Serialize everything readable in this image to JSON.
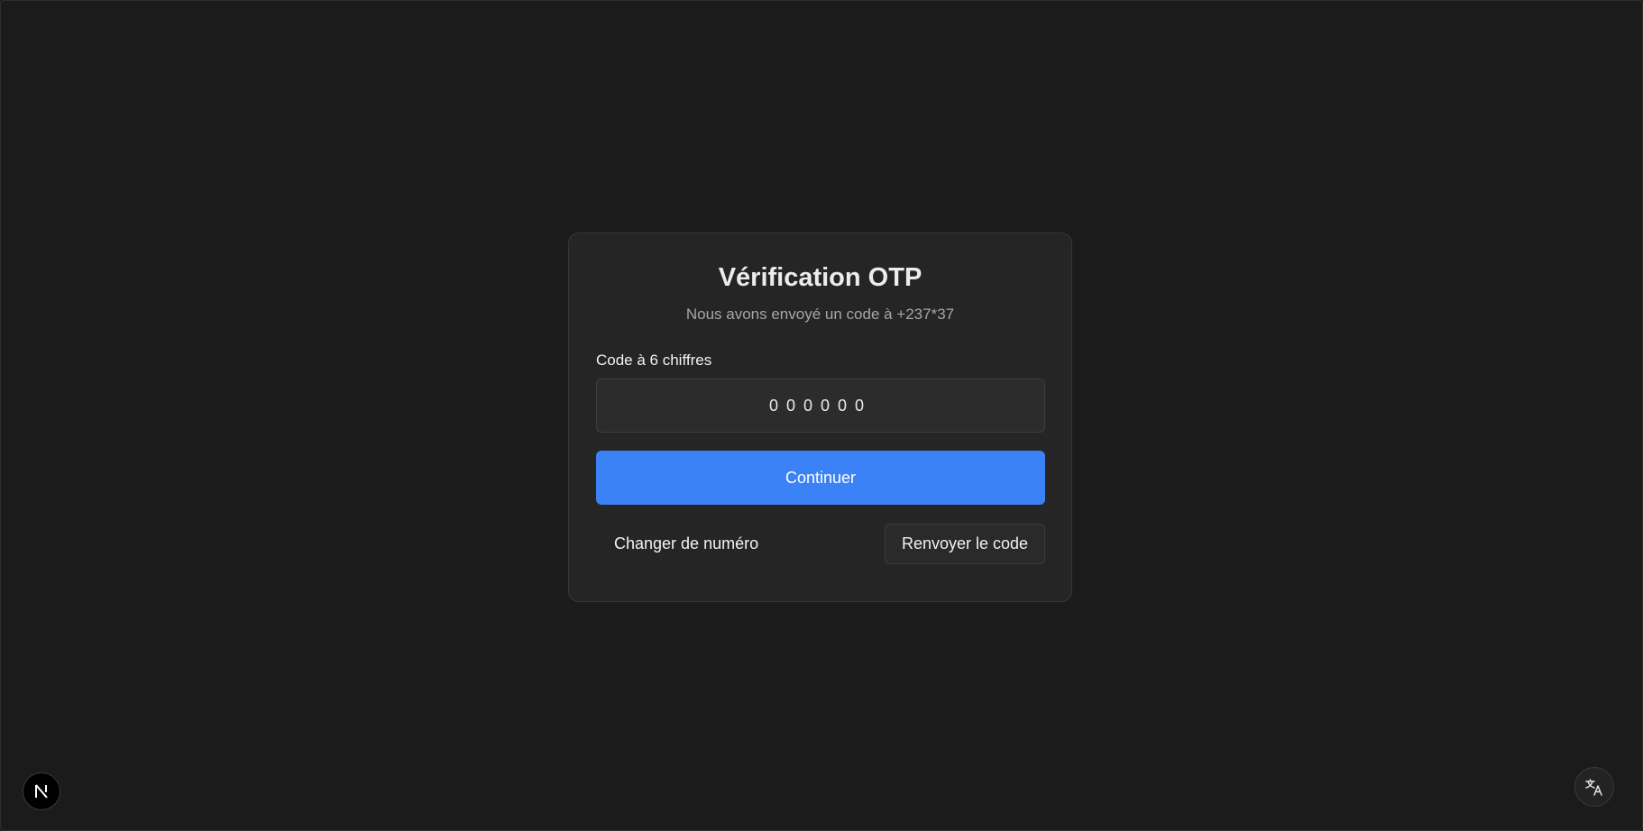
{
  "card": {
    "title": "Vérification OTP",
    "subtitle": "Nous avons envoyé un code à +237*37",
    "code_label": "Code à 6 chiffres",
    "code_placeholder": "000000",
    "continue_label": "Continuer",
    "change_number_label": "Changer de numéro",
    "resend_label": "Renvoyer le code"
  },
  "icons": {
    "corner_badge": "nextjs-logo-icon",
    "translate": "translate-icon"
  },
  "colors": {
    "background": "#1b1b1b",
    "card": "#252525",
    "primary": "#3b82f6"
  }
}
